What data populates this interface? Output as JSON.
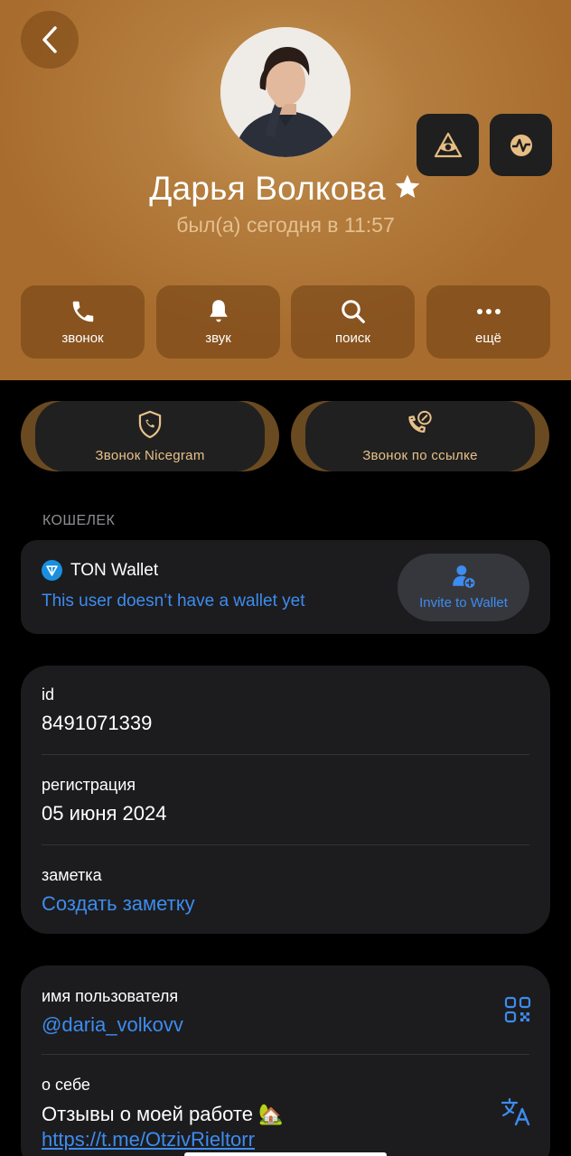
{
  "profile": {
    "name": "Дарья Волкова",
    "status": "был(а) сегодня в 11:57"
  },
  "actions": {
    "call": "звонок",
    "sound": "звук",
    "search": "поиск",
    "more": "ещё"
  },
  "calls": {
    "nicegram": "Звонок Nicegram",
    "by_link": "Звонок по ссылке"
  },
  "wallet": {
    "section_title": "КОШЕЛЕК",
    "title": "TON Wallet",
    "subtitle": "This user doesn’t have a wallet yet",
    "invite": "Invite to Wallet"
  },
  "info": {
    "id_label": "id",
    "id_value": "8491071339",
    "reg_label": "регистрация",
    "reg_value": "05 июня 2024",
    "note_label": "заметка",
    "note_value": "Создать заметку"
  },
  "user": {
    "username_label": "имя пользователя",
    "username_value": "@daria_volkovv",
    "bio_label": "о себе",
    "bio_text": "Отзывы о моей работе",
    "bio_emoji": "🏡",
    "bio_link": "https://t.me/OtzivRieltorr"
  },
  "colors": {
    "header": "#b47d3e",
    "accent_link": "#3d8cf0",
    "call_text": "#e8c18a",
    "card_bg": "#1c1c1e"
  }
}
